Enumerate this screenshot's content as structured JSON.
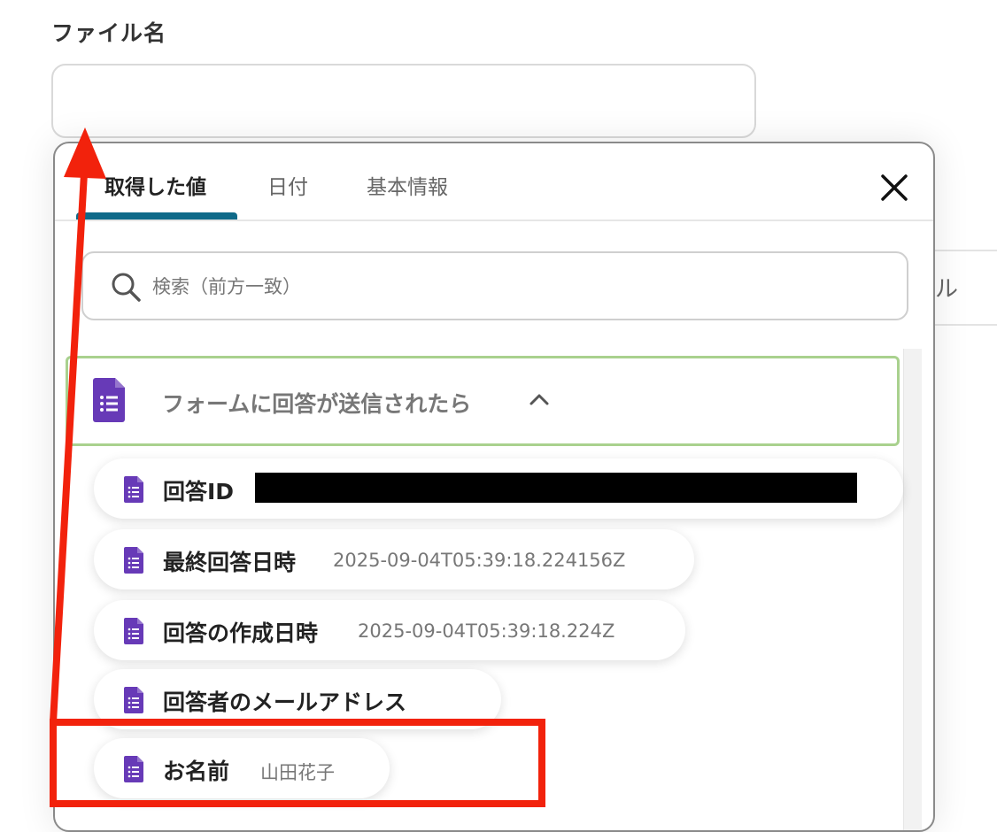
{
  "field": {
    "label": "ファイル名",
    "value": "",
    "placeholder": ""
  },
  "background": {
    "partial_text": "ル"
  },
  "popup": {
    "tabs": [
      {
        "label": "取得した値",
        "active": true
      },
      {
        "label": "日付",
        "active": false
      },
      {
        "label": "基本情報",
        "active": false
      }
    ],
    "search": {
      "placeholder": "検索（前方一致）",
      "value": ""
    },
    "group": {
      "title": "フォームに回答が送信されたら",
      "expanded": true,
      "icon": "google-forms-icon"
    },
    "items": [
      {
        "label": "回答ID",
        "value": "",
        "redacted": true
      },
      {
        "label": "最終回答日時",
        "value": "2025-09-04T05:39:18.224156Z"
      },
      {
        "label": "回答の作成日時",
        "value": "2025-09-04T05:39:18.224Z"
      },
      {
        "label": "回答者のメールアドレス",
        "value": ""
      },
      {
        "label": "お名前",
        "value": "山田花子"
      }
    ]
  },
  "colors": {
    "tab_underline": "#0f6a89",
    "group_border": "#a9d18e",
    "forms_icon": "#673ab7",
    "annotation": "#f2220c"
  }
}
